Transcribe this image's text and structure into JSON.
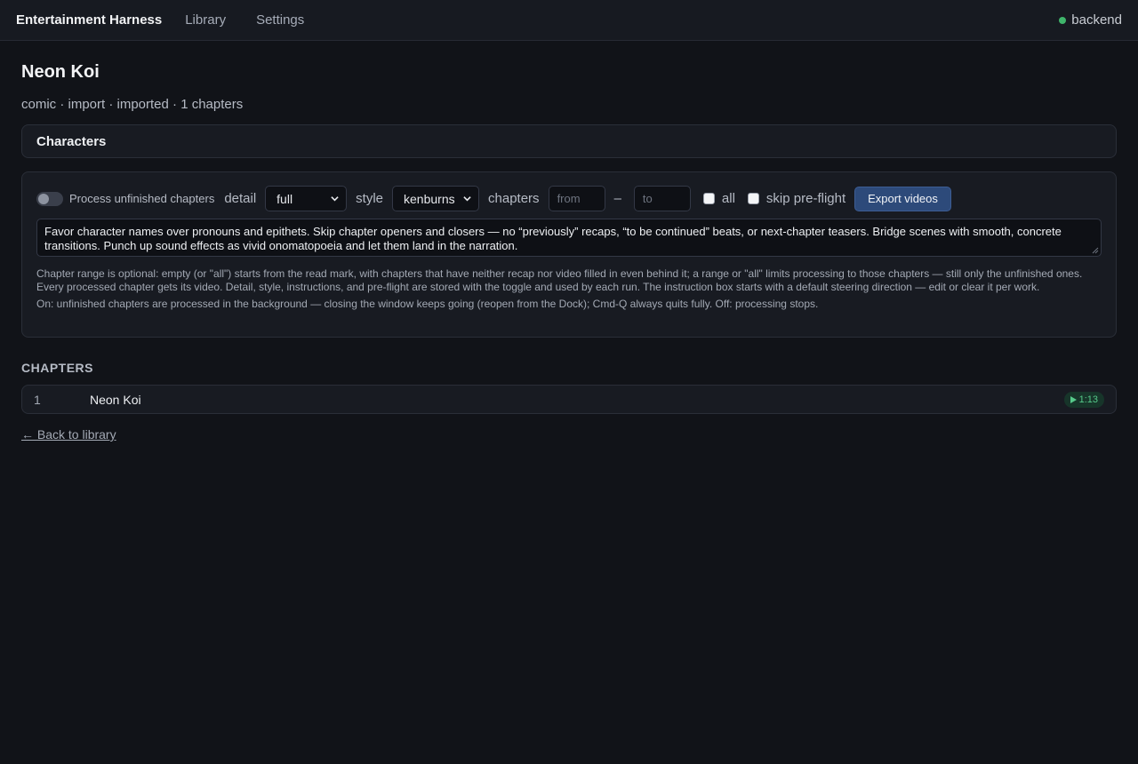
{
  "topbar": {
    "brand": "Entertainment Harness",
    "nav": [
      {
        "label": "Library"
      },
      {
        "label": "Settings"
      }
    ],
    "status": {
      "label": "backend",
      "color": "#3fb56b"
    }
  },
  "work": {
    "title": "Neon Koi",
    "meta": "comic · import · imported · 1 chapters"
  },
  "characters": {
    "label": "Characters"
  },
  "process": {
    "toggle_label": "Process unfinished chapters",
    "toggle_on": false,
    "detail_label": "detail",
    "detail_value": "full",
    "style_label": "style",
    "style_value": "kenburns",
    "chapters_label": "chapters",
    "from_placeholder": "from",
    "dash": "–",
    "to_placeholder": "to",
    "all_label": "all",
    "all_checked": false,
    "skip_label": "skip pre-flight",
    "skip_checked": false,
    "export_button": "Export videos",
    "instructions": "Favor character names over pronouns and epithets. Skip chapter openers and closers — no “previously” recaps, “to be continued” beats, or next-chapter teasers. Bridge scenes with smooth, concrete transitions. Punch up sound effects as vivid onomatopoeia and let them land in the narration.",
    "help_range": "Chapter range is optional: empty (or \"all\") starts from the read mark, with chapters that have neither recap nor video filled in even behind it; a range or \"all\" limits processing to those chapters — still only the unfinished ones. Every processed chapter gets its video. Detail, style, instructions, and pre-flight are stored with the toggle and used by each run. The instruction box starts with a default steering direction — edit or clear it per work.",
    "help_toggle": "On: unfinished chapters are processed in the background — closing the window keeps going (reopen from the Dock); Cmd-Q always quits fully. Off: processing stops."
  },
  "chapters": {
    "heading": "CHAPTERS",
    "items": [
      {
        "number": "1",
        "title": "Neon Koi",
        "duration": "1:13"
      }
    ]
  },
  "back_link": "← Back to library",
  "colors": {
    "background": "#111318",
    "accent_button": "#2d4a7a",
    "badge_text": "#56c98a"
  }
}
